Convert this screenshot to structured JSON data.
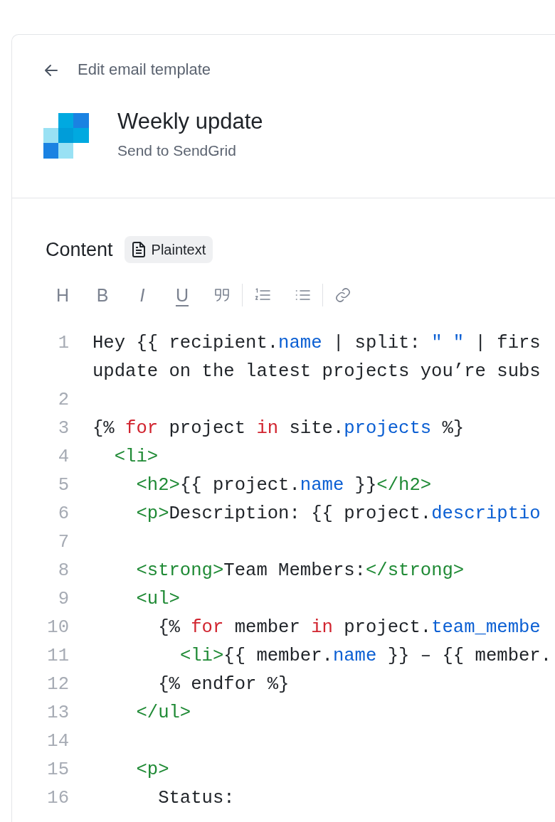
{
  "header": {
    "back_label": "Edit email template",
    "title": "Weekly update",
    "subtitle": "Send to SendGrid"
  },
  "content": {
    "heading": "Content",
    "format_badge": "Plaintext"
  },
  "toolbar": [
    {
      "kind": "heading",
      "label": "H"
    },
    {
      "kind": "bold",
      "label": "B"
    },
    {
      "kind": "italic",
      "label": "I"
    },
    {
      "kind": "underline",
      "label": "U"
    },
    {
      "kind": "quote"
    },
    {
      "kind": "divider"
    },
    {
      "kind": "ordered-list"
    },
    {
      "kind": "bullet-list"
    },
    {
      "kind": "divider"
    },
    {
      "kind": "link"
    }
  ],
  "code_lines": [
    {
      "number": "1",
      "rows": [
        [
          {
            "kind": "plain",
            "text": "Hey {{ recipient."
          },
          {
            "kind": "property",
            "text": "name"
          },
          {
            "kind": "plain",
            "text": " | split: "
          },
          {
            "kind": "property",
            "text": "\" \""
          },
          {
            "kind": "plain",
            "text": " | firs"
          }
        ],
        [
          {
            "kind": "plain",
            "text": "update on the latest projects you’re subs"
          }
        ]
      ]
    },
    {
      "number": "2",
      "rows": [
        []
      ]
    },
    {
      "number": "3",
      "rows": [
        [
          {
            "kind": "plain",
            "text": "{% "
          },
          {
            "kind": "keyword",
            "text": "for"
          },
          {
            "kind": "plain",
            "text": " project "
          },
          {
            "kind": "keyword",
            "text": "in"
          },
          {
            "kind": "plain",
            "text": " site."
          },
          {
            "kind": "property",
            "text": "projects"
          },
          {
            "kind": "plain",
            "text": " %}"
          }
        ]
      ]
    },
    {
      "number": "4",
      "rows": [
        [
          {
            "kind": "plain",
            "text": "  "
          },
          {
            "kind": "tag",
            "text": "<li>"
          }
        ]
      ]
    },
    {
      "number": "5",
      "rows": [
        [
          {
            "kind": "plain",
            "text": "    "
          },
          {
            "kind": "tag",
            "text": "<h2>"
          },
          {
            "kind": "plain",
            "text": "{{ project."
          },
          {
            "kind": "property",
            "text": "name"
          },
          {
            "kind": "plain",
            "text": " }}"
          },
          {
            "kind": "tag",
            "text": "</h2>"
          }
        ]
      ]
    },
    {
      "number": "6",
      "rows": [
        [
          {
            "kind": "plain",
            "text": "    "
          },
          {
            "kind": "tag",
            "text": "<p>"
          },
          {
            "kind": "plain",
            "text": "Description: {{ project."
          },
          {
            "kind": "property",
            "text": "descriptio"
          }
        ]
      ]
    },
    {
      "number": "7",
      "rows": [
        []
      ]
    },
    {
      "number": "8",
      "rows": [
        [
          {
            "kind": "plain",
            "text": "    "
          },
          {
            "kind": "tag",
            "text": "<strong>"
          },
          {
            "kind": "plain",
            "text": "Team Members:"
          },
          {
            "kind": "tag",
            "text": "</strong>"
          }
        ]
      ]
    },
    {
      "number": "9",
      "rows": [
        [
          {
            "kind": "plain",
            "text": "    "
          },
          {
            "kind": "tag",
            "text": "<ul>"
          }
        ]
      ]
    },
    {
      "number": "10",
      "rows": [
        [
          {
            "kind": "plain",
            "text": "      {% "
          },
          {
            "kind": "keyword",
            "text": "for"
          },
          {
            "kind": "plain",
            "text": " member "
          },
          {
            "kind": "keyword",
            "text": "in"
          },
          {
            "kind": "plain",
            "text": " project."
          },
          {
            "kind": "property",
            "text": "team_membe"
          }
        ]
      ]
    },
    {
      "number": "11",
      "rows": [
        [
          {
            "kind": "plain",
            "text": "        "
          },
          {
            "kind": "tag",
            "text": "<li>"
          },
          {
            "kind": "plain",
            "text": "{{ member."
          },
          {
            "kind": "property",
            "text": "name"
          },
          {
            "kind": "plain",
            "text": " }} – {{ member."
          }
        ]
      ]
    },
    {
      "number": "12",
      "rows": [
        [
          {
            "kind": "plain",
            "text": "      {% endfor %}"
          }
        ]
      ]
    },
    {
      "number": "13",
      "rows": [
        [
          {
            "kind": "plain",
            "text": "    "
          },
          {
            "kind": "tag",
            "text": "</ul>"
          }
        ]
      ]
    },
    {
      "number": "14",
      "rows": [
        []
      ]
    },
    {
      "number": "15",
      "rows": [
        [
          {
            "kind": "plain",
            "text": "    "
          },
          {
            "kind": "tag",
            "text": "<p>"
          }
        ]
      ]
    },
    {
      "number": "16",
      "rows": [
        [
          {
            "kind": "plain",
            "text": "      Status:"
          }
        ]
      ]
    }
  ]
}
